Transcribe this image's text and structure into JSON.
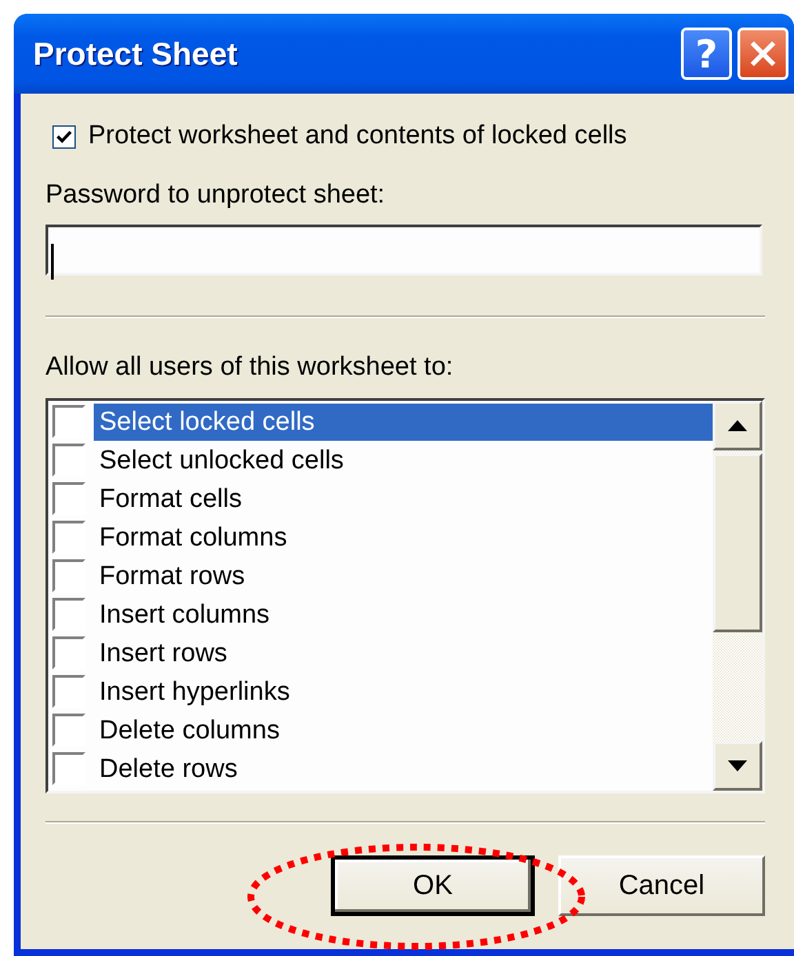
{
  "window": {
    "title": "Protect Sheet",
    "help_button": "?"
  },
  "protect_option": {
    "label": "Protect worksheet and contents of locked cells",
    "checked": true
  },
  "password": {
    "label": "Password to unprotect sheet:"
  },
  "permissions": {
    "label": "Allow all users of this worksheet to:",
    "items": [
      {
        "label": "Select locked cells",
        "checked": false,
        "selected": true
      },
      {
        "label": "Select unlocked cells",
        "checked": false,
        "selected": false
      },
      {
        "label": "Format cells",
        "checked": false,
        "selected": false
      },
      {
        "label": "Format columns",
        "checked": false,
        "selected": false
      },
      {
        "label": "Format rows",
        "checked": false,
        "selected": false
      },
      {
        "label": "Insert columns",
        "checked": false,
        "selected": false
      },
      {
        "label": "Insert rows",
        "checked": false,
        "selected": false
      },
      {
        "label": "Insert hyperlinks",
        "checked": false,
        "selected": false
      },
      {
        "label": "Delete columns",
        "checked": false,
        "selected": false
      },
      {
        "label": "Delete rows",
        "checked": false,
        "selected": false
      }
    ]
  },
  "buttons": [
    {
      "label": "OK",
      "default": true
    },
    {
      "label": "Cancel",
      "default": false
    }
  ]
}
